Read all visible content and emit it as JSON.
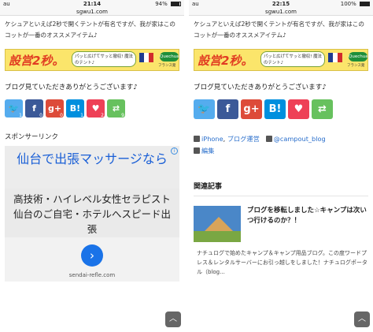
{
  "left": {
    "status": {
      "carrier": "au",
      "time": "21:14",
      "battery": "94%",
      "battery_level": 0.94
    },
    "url": "sgwu1.com",
    "paragraph": "ケシュアといえば2秒で開くテントが有名ですが、我が家はこのコットが一番のオススメアイテム♪",
    "banner": {
      "headline": "設営2秒。",
      "bubble": "パッと広げてサッと撤収! 魔法のテント♪",
      "logo": "Quechua",
      "caption": "フランス発"
    },
    "thanks": "ブログ見ていただきありがとうございます♪",
    "share": [
      {
        "glyph": "🐦",
        "count": "1",
        "color": "#55acee"
      },
      {
        "glyph": "f",
        "count": "0",
        "color": "#3b5998"
      },
      {
        "glyph": "g+",
        "count": "0",
        "color": "#dd4b39"
      },
      {
        "glyph": "B!",
        "count": "1",
        "color": "#008fde"
      },
      {
        "glyph": "♥",
        "count": "2",
        "color": "#ee4056"
      },
      {
        "glyph": "⇄",
        "count": "9",
        "color": "#67c15e"
      }
    ],
    "sponsor": "スポンサーリンク",
    "ad": {
      "headline": "仙台で出張マッサージなら",
      "body": "高技術・ハイレベル女性セラピスト 仙台のご自宅・ホテルへスピード出張",
      "cta": "›",
      "site": "sendai-refle.com",
      "info": "i"
    },
    "scroll_top": "︿"
  },
  "right": {
    "status": {
      "carrier": "au",
      "time": "22:15",
      "battery": "100%",
      "battery_level": 1.0
    },
    "url": "sgwu1.com",
    "paragraph": "ケシュアといえば2秒で開くテントが有名ですが、我が家はこのコットが一番のオススメアイテム♪",
    "banner": {
      "headline": "設営2秒。",
      "bubble": "パッと広げてサッと撤収! 魔法のテント♪",
      "logo": "Quechua",
      "caption": "フランス発"
    },
    "thanks": "ブログ見ていただきありがとうございます♪",
    "share": [
      {
        "glyph": "🐦",
        "color": "#55acee"
      },
      {
        "glyph": "f",
        "color": "#3b5998"
      },
      {
        "glyph": "g+",
        "color": "#dd4b39"
      },
      {
        "glyph": "B!",
        "color": "#008fde"
      },
      {
        "glyph": "♥",
        "color": "#ee4056"
      },
      {
        "glyph": "⇄",
        "color": "#67c15e"
      }
    ],
    "meta": {
      "tags": [
        "iPhone",
        "ブログ運営"
      ],
      "author": "@campout_blog",
      "edit": "編集"
    },
    "related_heading": "関連記事",
    "related": {
      "title": "ブログを移転しました☆キャンプは次いつ行けるのか？！",
      "excerpt": "ナチュログで始めたキャンプ＆キャンプ用品ブログ。この度ワードプレス＆レンタルサーバーにお引っ越しをしました！ナチュログポータル（blog..."
    },
    "scroll_top": "︿"
  },
  "colors": {
    "link": "#2a6fcc",
    "banner_bg": "#fbe56b",
    "banner_text": "#e13c22",
    "ad_link": "#1a5fd6",
    "cta": "#1a73e8"
  }
}
